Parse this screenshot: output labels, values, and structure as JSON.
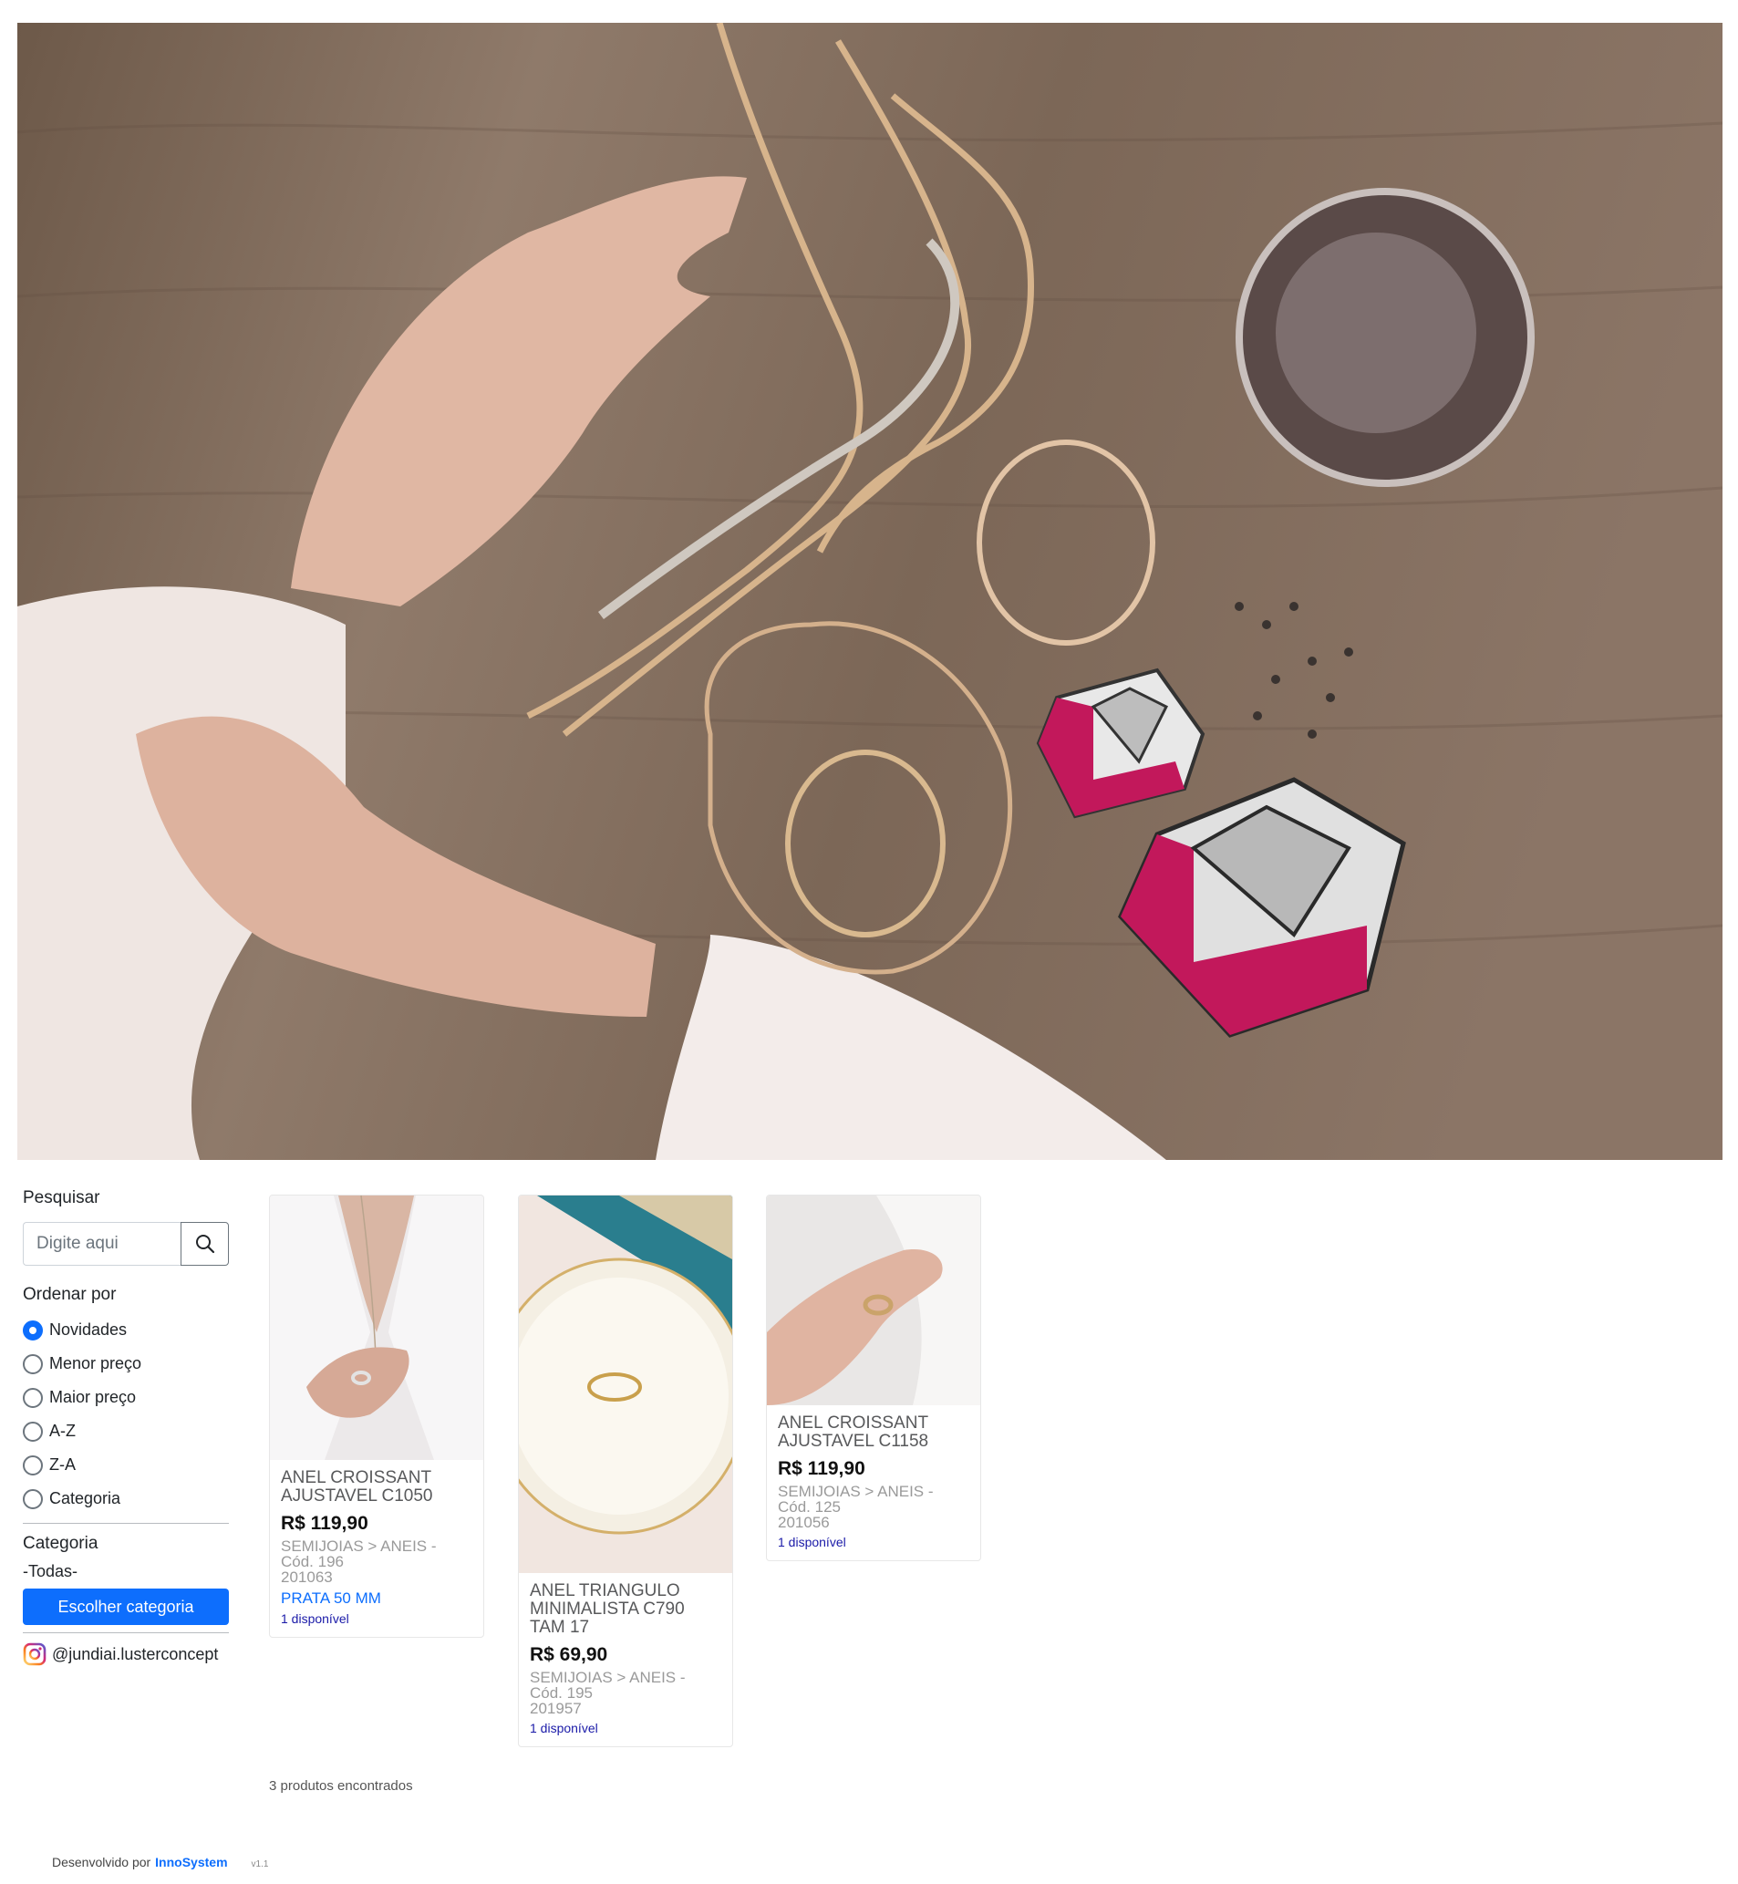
{
  "sidebar": {
    "search_label": "Pesquisar",
    "search_placeholder": "Digite aqui",
    "order_label": "Ordenar por",
    "order_options": [
      "Novidades",
      "Menor preço",
      "Maior preço",
      "A-Z",
      "Z-A",
      "Categoria"
    ],
    "order_selected": "Novidades",
    "category_label": "Categoria",
    "category_value": "-Todas-",
    "category_button": "Escolher categoria",
    "instagram": "@jundiai.lusterconcept"
  },
  "products": [
    {
      "title": "ANEL CROISSANT AJUSTAVEL C1050",
      "price": "R$ 119,90",
      "category": "SEMIJOIAS > ANEIS - Cód. 196",
      "code": "201063",
      "variant": "PRATA 50 MM",
      "availability": "1 disponível"
    },
    {
      "title": "ANEL TRIANGULO MINIMALISTA C790 TAM 17",
      "price": "R$ 69,90",
      "category": "SEMIJOIAS > ANEIS - Cód. 195",
      "code": "201957",
      "availability": "1 disponível"
    },
    {
      "title": "ANEL CROISSANT AJUSTAVEL C1158",
      "price": "R$ 119,90",
      "category": "SEMIJOIAS > ANEIS - Cód. 125",
      "code": "201056",
      "availability": "1 disponível"
    }
  ],
  "results_count": "3 produtos encontrados",
  "footer": {
    "prefix": "Desenvolvido por",
    "brand": "InnoSystem",
    "version": "v1.1"
  },
  "colors": {
    "primary": "#0d6efd",
    "wood": "#7d6756",
    "ruby": "#c2185b"
  }
}
